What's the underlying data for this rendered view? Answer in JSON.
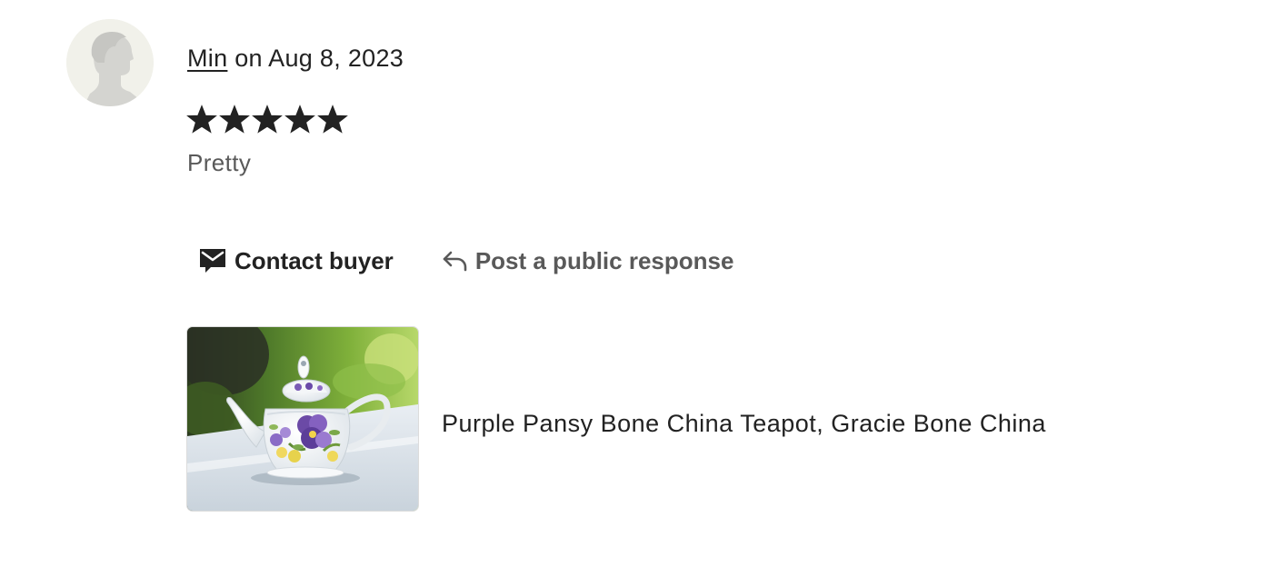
{
  "review": {
    "reviewer_name": "Min",
    "date_text": " on Aug 8, 2023",
    "rating": 5,
    "rating_max": 5,
    "text": "Pretty"
  },
  "actions": {
    "contact_buyer_label": "Contact buyer",
    "public_response_label": "Post a public response"
  },
  "item": {
    "title": "Purple Pansy Bone China Teapot, Gracie Bone China"
  },
  "icons": {
    "avatar": "default-user-avatar-icon",
    "star": "star-filled-icon",
    "contact": "envelope-message-icon",
    "reply": "reply-arrow-icon"
  },
  "colors": {
    "text_primary": "#222222",
    "text_secondary": "#595959",
    "avatar_bg": "#f1f1ea",
    "avatar_silhouette": "#d4d4d0"
  }
}
